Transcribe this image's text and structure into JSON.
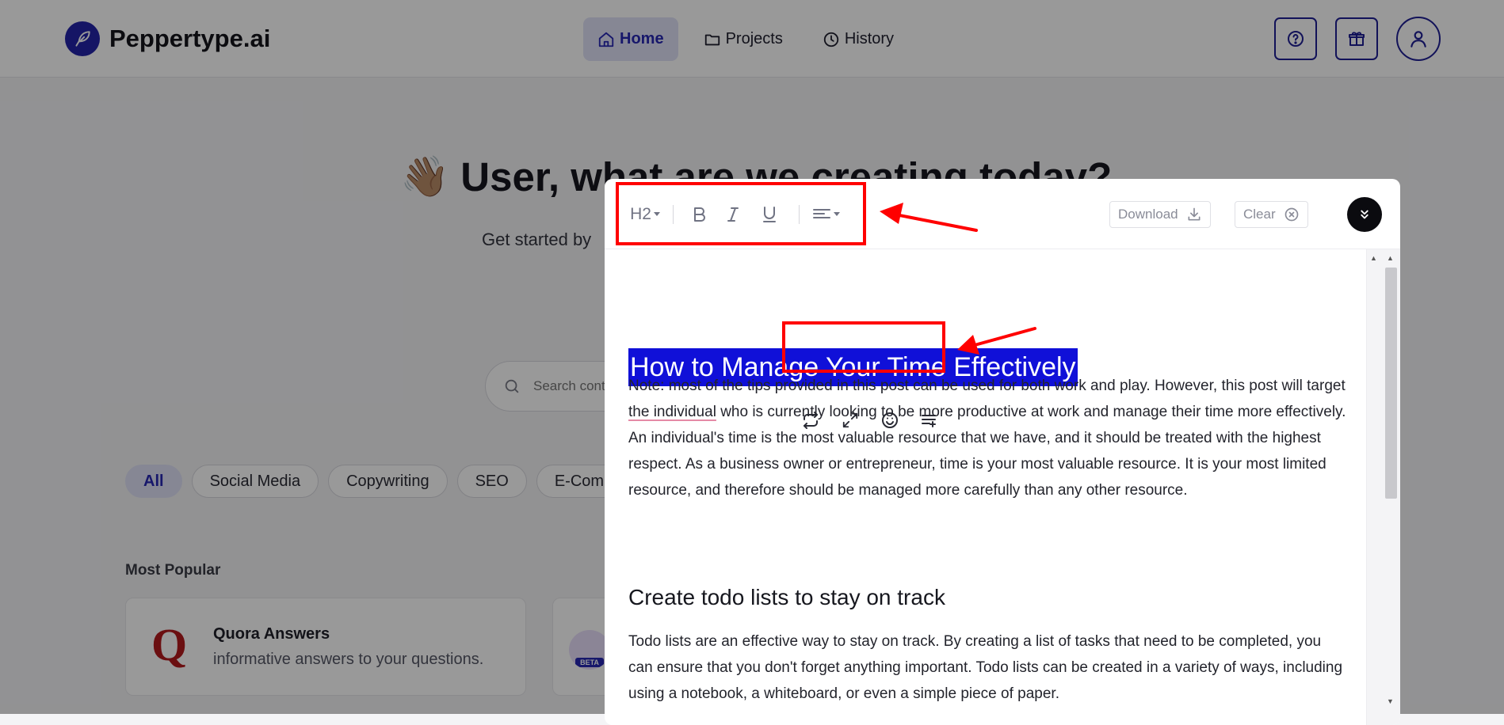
{
  "brand": {
    "name": "Peppertype.ai"
  },
  "nav": {
    "home": "Home",
    "projects": "Projects",
    "history": "History"
  },
  "header_icons": [
    "help-icon",
    "gift-icon",
    "user-icon"
  ],
  "hero": {
    "emoji": "👋🏽",
    "title": "User, what are we creating today?",
    "subtitle": "Get started by"
  },
  "search": {
    "placeholder": "Search content"
  },
  "categories": [
    "All",
    "Social Media",
    "Copywriting",
    "SEO",
    "E-Commerce"
  ],
  "most_popular": {
    "title": "Most Popular",
    "cards": [
      {
        "title": "Quora Answers",
        "description": "informative answers to your questions.",
        "logo": "Q"
      },
      {
        "badge": "BETA"
      }
    ]
  },
  "editor": {
    "toolbar": {
      "heading": "H2",
      "download_label": "Download",
      "clear_label": "Clear"
    },
    "title": "How to Manage Your Time Effectively",
    "paragraph1_start": "Note: most of the tips provided in this post can be used for both work and play. However, this post will target ",
    "paragraph1_underlined": "the individual",
    "paragraph1_end": " who is currently looking to be more productive at work and manage their time more effectively. An individual's time is the most valuable resource that we have, and it should be treated with the highest respect. As a business owner or entrepreneur, time is your most valuable resource. It is your most limited resource, and therefore should be managed more carefully than any other resource.",
    "heading2": "Create todo lists to stay on track",
    "paragraph2": "Todo lists are an effective way to stay on track. By creating a list of tasks that need to be completed, you can ensure that you don't forget anything important. Todo lists can be created in a variety of ways, including using a notebook, a whiteboard, or even a simple piece of paper."
  },
  "colors": {
    "brand_blue": "#2727b3",
    "selection": "#1010d8",
    "annotation": "#ff0000"
  }
}
